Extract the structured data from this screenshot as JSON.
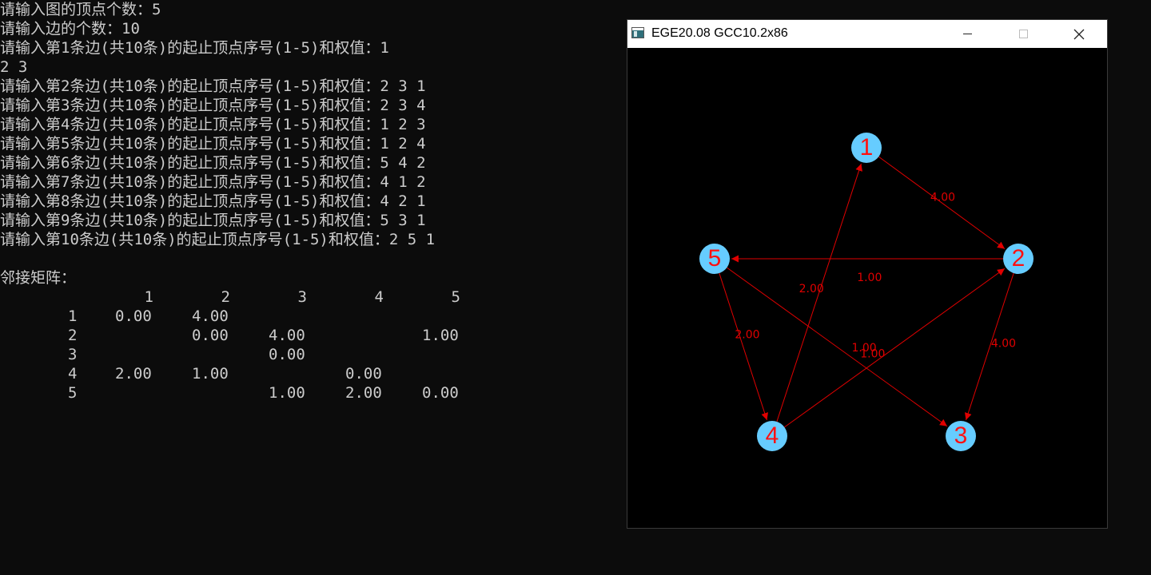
{
  "console": {
    "lines": [
      "请输入图的顶点个数：5",
      "请输入边的个数：10",
      "请输入第1条边(共10条)的起止顶点序号(1-5)和权值：1",
      "2 3",
      "请输入第2条边(共10条)的起止顶点序号(1-5)和权值：2 3 1",
      "请输入第3条边(共10条)的起止顶点序号(1-5)和权值：2 3 4",
      "请输入第4条边(共10条)的起止顶点序号(1-5)和权值：1 2 3",
      "请输入第5条边(共10条)的起止顶点序号(1-5)和权值：1 2 4",
      "请输入第6条边(共10条)的起止顶点序号(1-5)和权值：5 4 2",
      "请输入第7条边(共10条)的起止顶点序号(1-5)和权值：4 1 2",
      "请输入第8条边(共10条)的起止顶点序号(1-5)和权值：4 2 1",
      "请输入第9条边(共10条)的起止顶点序号(1-5)和权值：5 3 1",
      "请输入第10条边(共10条)的起止顶点序号(1-5)和权值：2 5 1"
    ],
    "matrix_title": "邻接矩阵：",
    "matrix": {
      "col_headers": [
        "1",
        "2",
        "3",
        "4",
        "5"
      ],
      "rows": [
        {
          "label": "1",
          "cells": [
            "0.00",
            "4.00",
            "",
            "",
            ""
          ]
        },
        {
          "label": "2",
          "cells": [
            "",
            "0.00",
            "4.00",
            "",
            "1.00"
          ]
        },
        {
          "label": "3",
          "cells": [
            "",
            "",
            "0.00",
            "",
            ""
          ]
        },
        {
          "label": "4",
          "cells": [
            "2.00",
            "1.00",
            "",
            "0.00",
            ""
          ]
        },
        {
          "label": "5",
          "cells": [
            "",
            "",
            "1.00",
            "2.00",
            "0.00"
          ]
        }
      ]
    }
  },
  "graph_window": {
    "title": "EGE20.08 GCC10.2x86",
    "colors": {
      "node_fill": "#66ccff",
      "node_label": "#ff1010",
      "edge": "#e00000",
      "background": "#000000"
    },
    "nodes": [
      {
        "id": 1,
        "label": "1"
      },
      {
        "id": 2,
        "label": "2"
      },
      {
        "id": 3,
        "label": "3"
      },
      {
        "id": 4,
        "label": "4"
      },
      {
        "id": 5,
        "label": "5"
      }
    ],
    "edges": [
      {
        "from": 1,
        "to": 2,
        "label": "4.00"
      },
      {
        "from": 2,
        "to": 5,
        "label": "1.00"
      },
      {
        "from": 2,
        "to": 3,
        "label": "4.00"
      },
      {
        "from": 5,
        "to": 4,
        "label": "2.00"
      },
      {
        "from": 4,
        "to": 1,
        "label": "2.00"
      },
      {
        "from": 4,
        "to": 2,
        "label": "1.00"
      },
      {
        "from": 5,
        "to": 3,
        "label": "1.00"
      }
    ]
  }
}
